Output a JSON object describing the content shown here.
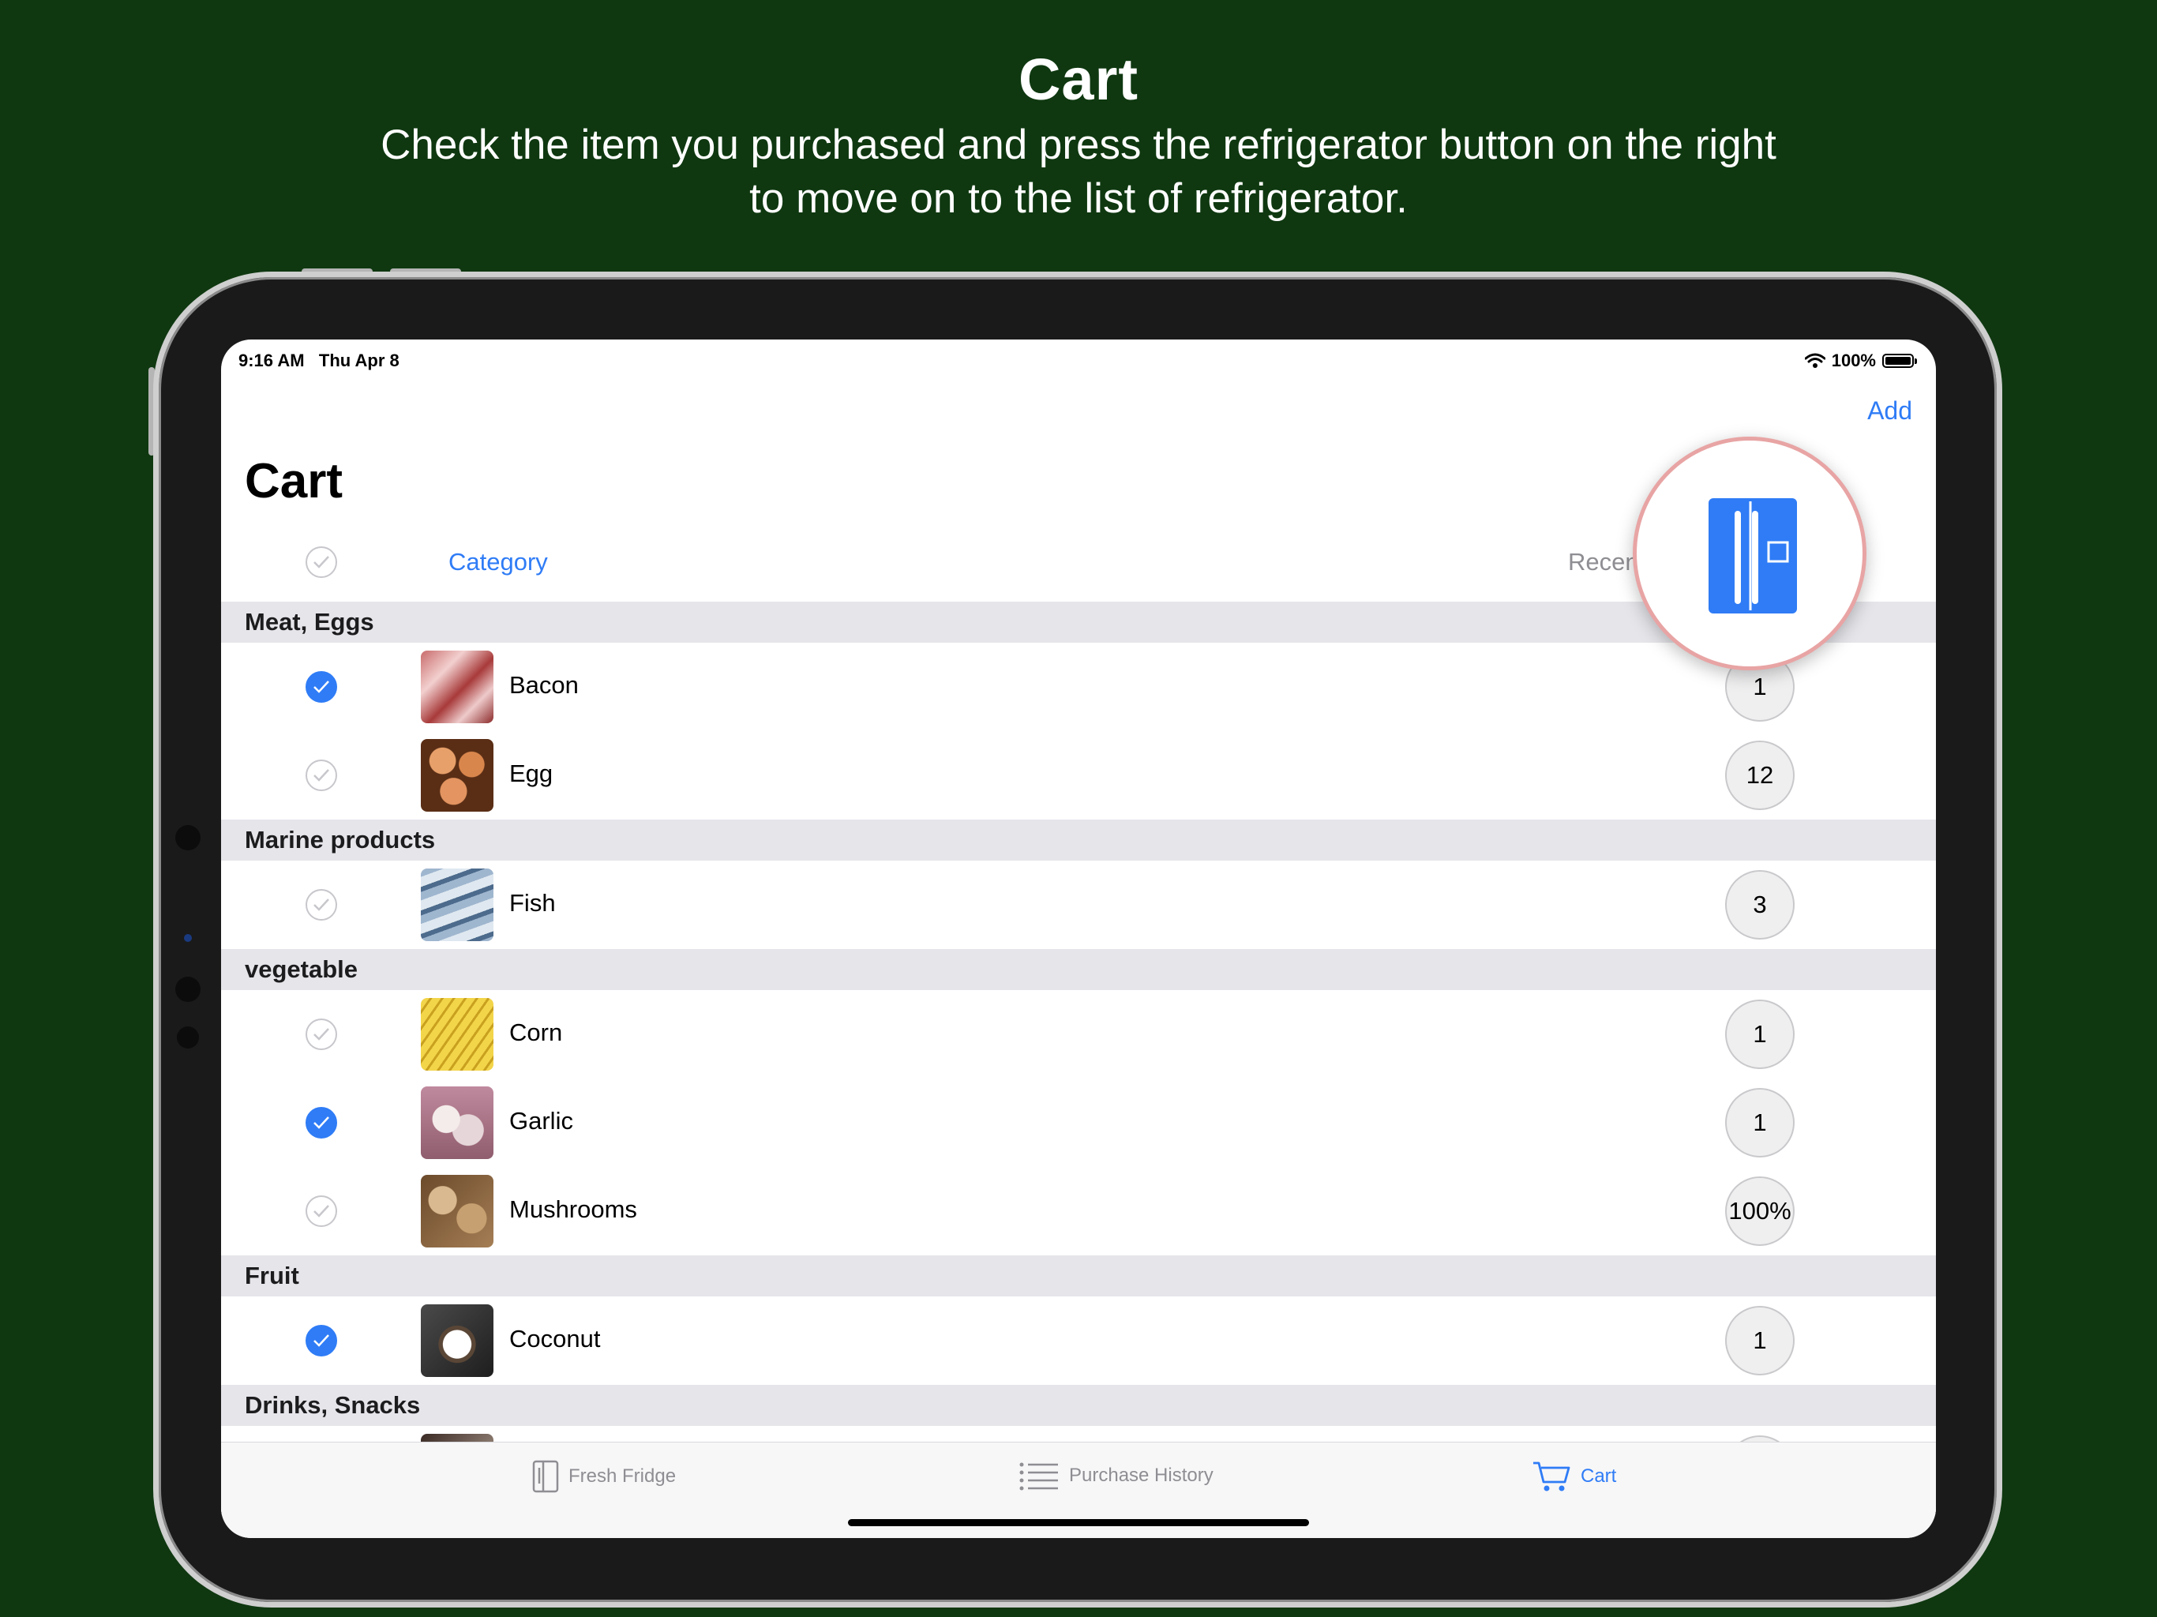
{
  "promo": {
    "title": "Cart",
    "subtitle_line1": "Check the item you purchased and press the refrigerator button on the right",
    "subtitle_line2": "to move on to the list of refrigerator."
  },
  "status_bar": {
    "time": "9:16 AM",
    "date": "Thu Apr 8",
    "battery": "100%"
  },
  "nav": {
    "add_label": "Add",
    "title": "Cart"
  },
  "sort": {
    "category_label": "Category",
    "recent_label": "Recen"
  },
  "sections": [
    {
      "title": "Meat, Eggs",
      "items": [
        {
          "name": "Bacon",
          "qty": "1",
          "checked": true
        },
        {
          "name": "Egg",
          "qty": "12",
          "checked": false
        }
      ]
    },
    {
      "title": "Marine products",
      "items": [
        {
          "name": "Fish",
          "qty": "3",
          "checked": false
        }
      ]
    },
    {
      "title": "vegetable",
      "items": [
        {
          "name": "Corn",
          "qty": "1",
          "checked": false
        },
        {
          "name": "Garlic",
          "qty": "1",
          "checked": true
        },
        {
          "name": "Mushrooms",
          "qty": "100%",
          "checked": false
        }
      ]
    },
    {
      "title": "Fruit",
      "items": [
        {
          "name": "Coconut",
          "qty": "1",
          "checked": true
        }
      ]
    },
    {
      "title": "Drinks, Snacks",
      "items": []
    }
  ],
  "tabs": [
    {
      "label": "Fresh Fridge",
      "icon": "fridge-icon",
      "active": false
    },
    {
      "label": "Purchase History",
      "icon": "list-icon",
      "active": false
    },
    {
      "label": "Cart",
      "icon": "cart-icon",
      "active": true
    }
  ],
  "colors": {
    "accent": "#2f7cf6",
    "background": "#0f3810",
    "highlight_ring": "#e8a4a4"
  }
}
